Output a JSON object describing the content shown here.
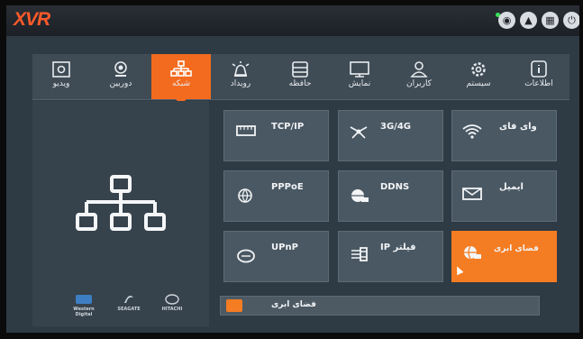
{
  "app": {
    "logo": "XVR"
  },
  "topbar": {
    "icons": [
      "eye-icon",
      "bell-icon",
      "grid-icon",
      "power-icon"
    ],
    "colors": {
      "logo": "#ff5a2a",
      "status_dot": "#39e05a"
    }
  },
  "menu": {
    "tabs": [
      {
        "label": "ویدیو",
        "icon": "video-icon"
      },
      {
        "label": "دوربین",
        "icon": "camera-icon"
      },
      {
        "label": "شبکه",
        "icon": "network-icon",
        "active": true
      },
      {
        "label": "رویداد",
        "icon": "alarm-icon"
      },
      {
        "label": "حافظه",
        "icon": "storage-icon"
      },
      {
        "label": "نمایش",
        "icon": "display-icon"
      },
      {
        "label": "کاربران",
        "icon": "user-icon"
      },
      {
        "label": "سیستم",
        "icon": "gear-icon"
      },
      {
        "label": "اطلاعات",
        "icon": "info-icon"
      }
    ]
  },
  "left": {
    "brands": [
      "Western Digital",
      "SEAGATE",
      "HITACHI"
    ]
  },
  "tiles": [
    {
      "label": "TCP/IP",
      "icon": "ethernet-icon"
    },
    {
      "label": "3G/4G",
      "icon": "mobile-network-icon"
    },
    {
      "label": "وای فای",
      "icon": "wifi-icon"
    },
    {
      "label": "PPPoE",
      "icon": "globe-icon"
    },
    {
      "label": "DDNS",
      "icon": "ddns-icon"
    },
    {
      "label": "ایمیل",
      "icon": "email-icon"
    },
    {
      "label": "UPnP",
      "icon": "upnp-icon"
    },
    {
      "label": "فیلتر IP",
      "icon": "ip-filter-icon"
    },
    {
      "label": "فضای ابری",
      "icon": "cloud-icon",
      "active": true
    }
  ],
  "status": {
    "text": "فضای ابری"
  },
  "colors": {
    "accent": "#f36b1f",
    "tile": "#4a5863",
    "panel": "#36424c"
  }
}
